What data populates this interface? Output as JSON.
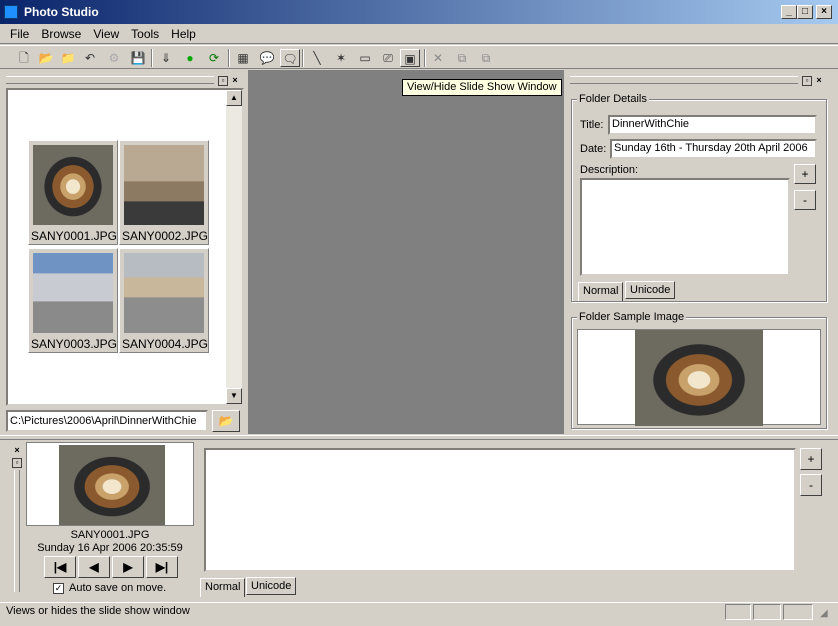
{
  "window": {
    "title": "Photo Studio"
  },
  "menu": [
    "File",
    "Browse",
    "View",
    "Tools",
    "Help"
  ],
  "tooltip": "View/Hide Slide Show Window",
  "thumbnails": [
    {
      "filename": "SANY0001.JPG",
      "image": "food-pan"
    },
    {
      "filename": "SANY0002.JPG",
      "image": "room-person"
    },
    {
      "filename": "SANY0003.JPG",
      "image": "balcony-sky"
    },
    {
      "filename": "SANY0004.JPG",
      "image": "balcony-houses"
    }
  ],
  "path": "C:\\Pictures\\2006\\April\\DinnerWithChie",
  "folder_details": {
    "label": "Folder Details",
    "title_label": "Title:",
    "title_value": "DinnerWithChie",
    "date_label": "Date:",
    "date_value": "Sunday 16th - Thursday 20th April 2006",
    "description_label": "Description:",
    "description_value": "",
    "plus": "+",
    "minus": "-",
    "tab_normal": "Normal",
    "tab_unicode": "Unicode"
  },
  "sample": {
    "label": "Folder Sample Image"
  },
  "preview": {
    "filename": "SANY0001.JPG",
    "datetime": "Sunday 16 Apr 2006 20:35:59",
    "autosave_label": "Auto save on move.",
    "autosave_checked": true
  },
  "bottom": {
    "text_value": "",
    "plus": "+",
    "minus": "-",
    "tab_normal": "Normal",
    "tab_unicode": "Unicode"
  },
  "status": {
    "text": "Views or hides the slide show window"
  },
  "colors": {
    "titlebar": "#0a246a",
    "slideshow_bg": "#808080",
    "face": "#d4d0c8"
  }
}
